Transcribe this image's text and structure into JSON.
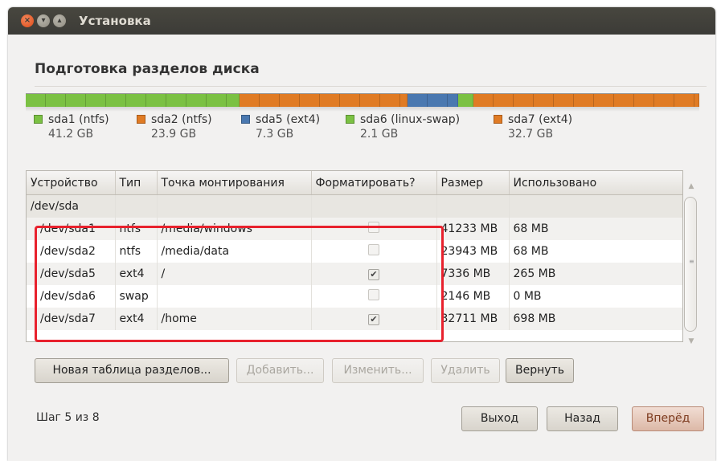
{
  "window": {
    "title": "Установка",
    "close_glyph": "×",
    "min_glyph": "▾",
    "max_glyph": "▴"
  },
  "page": {
    "heading": "Подготовка разделов диска"
  },
  "partitions_bar": [
    {
      "name": "sda1 (ntfs)",
      "size": "41.2 GB",
      "color": "#7bc143",
      "fraction": 0.2856
    },
    {
      "name": "sda2 (ntfs)",
      "size": "23.9 GB",
      "color": "#e07b24",
      "fraction": 0.2242
    },
    {
      "name": "sda5 (ext4)",
      "size": "7.3 GB",
      "color": "#4a78b0",
      "fraction": 0.0681
    },
    {
      "name": "sda6 (linux-swap)",
      "size": "2.1 GB",
      "color": "#7bc143",
      "fraction": 0.0203
    },
    {
      "name": "sda7 (ext4)",
      "size": "32.7 GB",
      "color": "#e07b24",
      "fraction": 0.3018
    }
  ],
  "table": {
    "headers": [
      "Устройство",
      "Тип",
      "Точка монтирования",
      "Форматировать?",
      "Размер",
      "Использовано"
    ],
    "parent_row": "/dev/sda",
    "rows": [
      {
        "device": "/dev/sda1",
        "type": "ntfs",
        "mount": "/media/windows",
        "format": false,
        "size": "41233 MB",
        "used": "68 MB"
      },
      {
        "device": "/dev/sda2",
        "type": "ntfs",
        "mount": "/media/data",
        "format": false,
        "size": "23943 MB",
        "used": "68 MB"
      },
      {
        "device": "/dev/sda5",
        "type": "ext4",
        "mount": "/",
        "format": true,
        "size": "7336 MB",
        "used": "265 MB"
      },
      {
        "device": "/dev/sda6",
        "type": "swap",
        "mount": "",
        "format": false,
        "size": "2146 MB",
        "used": "0 MB"
      },
      {
        "device": "/dev/sda7",
        "type": "ext4",
        "mount": "/home",
        "format": true,
        "size": "32711 MB",
        "used": "698 MB"
      }
    ]
  },
  "actions": {
    "new_table": "Новая таблица разделов...",
    "add": "Добавить...",
    "change": "Изменить...",
    "delete": "Удалить",
    "revert": "Вернуть"
  },
  "footer": {
    "step": "Шаг 5 из 8",
    "quit": "Выход",
    "back": "Назад",
    "forward": "Вперёд"
  },
  "checkmark_glyph": "✔",
  "scroll_up_glyph": "▲",
  "scroll_down_glyph": "▼",
  "scroll_grip_glyph": "≡"
}
